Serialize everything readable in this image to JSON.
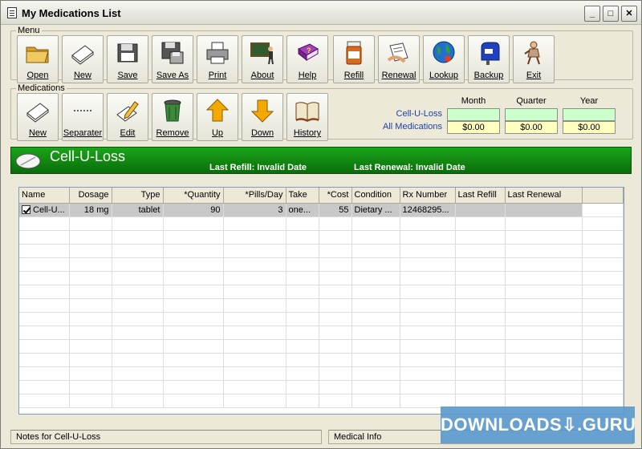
{
  "window": {
    "title": "My Medications List"
  },
  "menu": {
    "label": "Menu",
    "buttons": [
      {
        "label": "Open",
        "icon": "folder-icon"
      },
      {
        "label": "New",
        "icon": "new-document-icon"
      },
      {
        "label": "Save",
        "icon": "save-icon"
      },
      {
        "label": "Save As",
        "icon": "save-as-icon"
      },
      {
        "label": "Print",
        "icon": "printer-icon"
      },
      {
        "label": "About",
        "icon": "chalkboard-icon"
      },
      {
        "label": "Help",
        "icon": "help-book-icon"
      },
      {
        "label": "Refill",
        "icon": "pill-bottle-icon"
      },
      {
        "label": "Renewal",
        "icon": "prescription-icon"
      },
      {
        "label": "Lookup",
        "icon": "globe-icon"
      },
      {
        "label": "Backup",
        "icon": "mailbox-icon"
      },
      {
        "label": "Exit",
        "icon": "exit-man-icon"
      }
    ]
  },
  "medications": {
    "label": "Medications",
    "buttons": [
      {
        "label": "New",
        "icon": "new-document-icon"
      },
      {
        "label": "Separater",
        "icon": "separator-icon"
      },
      {
        "label": "Edit",
        "icon": "edit-pencil-icon"
      },
      {
        "label": "Remove",
        "icon": "trash-icon"
      },
      {
        "label": "Up",
        "icon": "up-arrow-icon"
      },
      {
        "label": "Down",
        "icon": "down-arrow-icon"
      },
      {
        "label": "History",
        "icon": "history-book-icon"
      }
    ]
  },
  "summary": {
    "headers": [
      "Month",
      "Quarter",
      "Year"
    ],
    "rows": [
      {
        "label": "Cell-U-Loss",
        "values": [
          "",
          "",
          ""
        ]
      },
      {
        "label": "All Medications",
        "values": [
          "$0.00",
          "$0.00",
          "$0.00"
        ]
      }
    ]
  },
  "banner": {
    "name": "Cell-U-Loss",
    "last_refill": "Last Refill: Invalid Date",
    "last_renewal": "Last Renewal: Invalid Date"
  },
  "table": {
    "columns": [
      "Name",
      "Dosage",
      "Type",
      "*Quantity",
      "*Pills/Day",
      "Take",
      "*Cost",
      "Condition",
      "Rx Number",
      "Last Refill",
      "Last Renewal",
      ""
    ],
    "rows": [
      {
        "checked": true,
        "name": "Cell-U...",
        "dosage": "18 mg",
        "type": "tablet",
        "quantity": "90",
        "pills_per_day": "3",
        "take": "one...",
        "cost": "55",
        "condition": "Dietary ...",
        "rx_number": "12468295...",
        "last_refill": "",
        "last_renewal": ""
      }
    ]
  },
  "status": {
    "notes": "Notes for Cell-U-Loss",
    "medical_info": "Medical Info"
  },
  "watermark": "DOWNLOADS⇩.GURU"
}
